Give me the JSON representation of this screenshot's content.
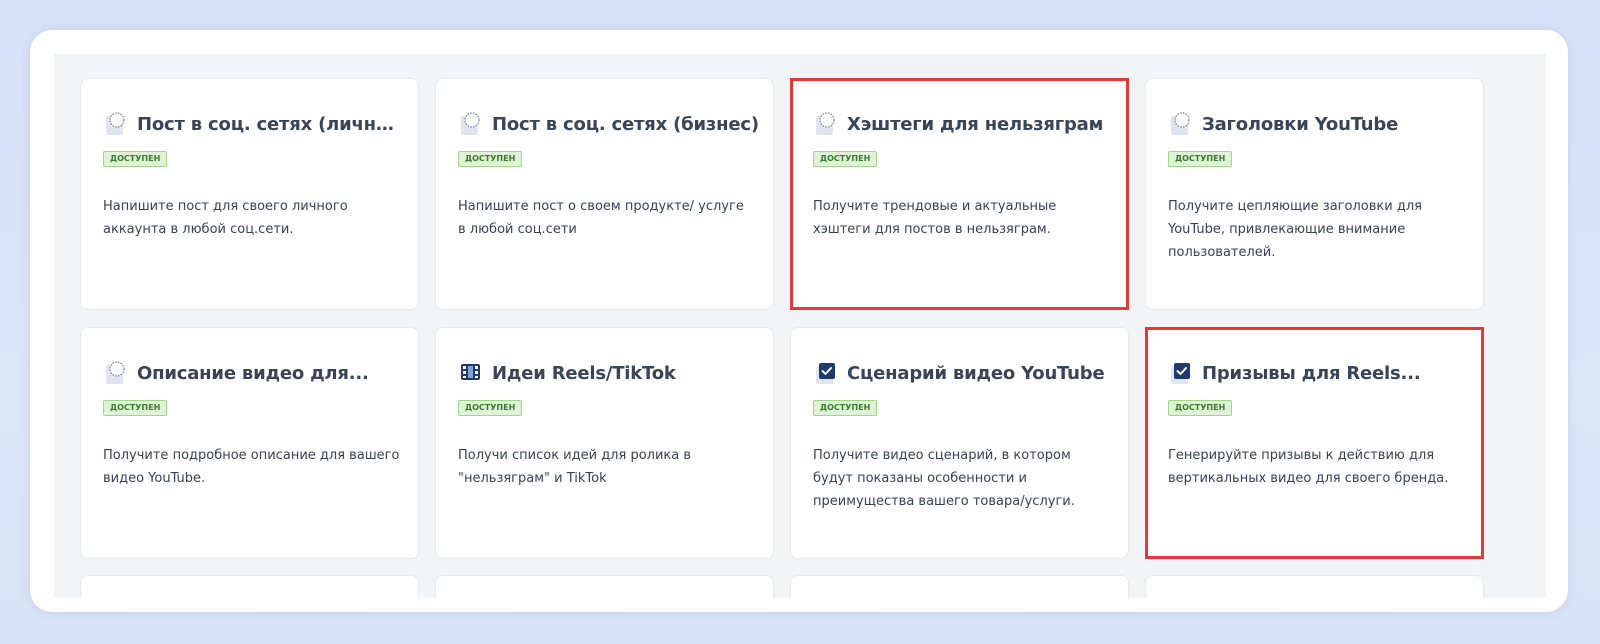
{
  "accent_colors": {
    "highlight": "#e53935",
    "badge_text": "#3b7a2e",
    "badge_bg": "#dff3d6",
    "title": "#3a4459",
    "icon_dark": "#1f3b6b"
  },
  "cards": [
    {
      "title": "Пост в соц. сетях (личный)",
      "badge": "доступен",
      "description": "Напишите пост для своего личного аккаунта в любой соц.сети.",
      "icon": "speech-bubble-icon",
      "highlighted": false
    },
    {
      "title": "Пост в соц. сетях (бизнес)",
      "badge": "доступен",
      "description": "Напишите пост о своем продукте/ услуге в любой соц.сети",
      "icon": "speech-bubble-icon",
      "highlighted": false
    },
    {
      "title": "Хэштеги для нельзяграм",
      "badge": "доступен",
      "description": "Получите трендовые и актуальные хэштеги для постов в нельзяграм.",
      "icon": "speech-bubble-icon",
      "highlighted": true
    },
    {
      "title": "Заголовки YouTube",
      "badge": "доступен",
      "description": "Получите цепляющие заголовки для YouTube, привлекающие внимание пользователей.",
      "icon": "speech-bubble-icon",
      "highlighted": false
    },
    {
      "title": "Описание видео для...",
      "badge": "доступен",
      "description": "Получите подробное описание для вашего видео YouTube.",
      "icon": "speech-bubble-icon",
      "highlighted": false
    },
    {
      "title": "Идеи Reels/TikTok",
      "badge": "доступен",
      "description": "Получи список идей для ролика в \"нельзяграм\" и TikTok",
      "icon": "film-icon",
      "highlighted": false
    },
    {
      "title": "Сценарий видео YouTube",
      "badge": "доступен",
      "description": "Получите видео сценарий, в котором будут показаны особенности и преимущества вашего товара/услуги.",
      "icon": "checkbox-icon",
      "highlighted": false
    },
    {
      "title": "Призывы для Reels...",
      "badge": "доступен",
      "description": "Генерируйте призывы к действию для вертикальных видео для своего бренда.",
      "icon": "checkbox-icon",
      "highlighted": true
    }
  ]
}
